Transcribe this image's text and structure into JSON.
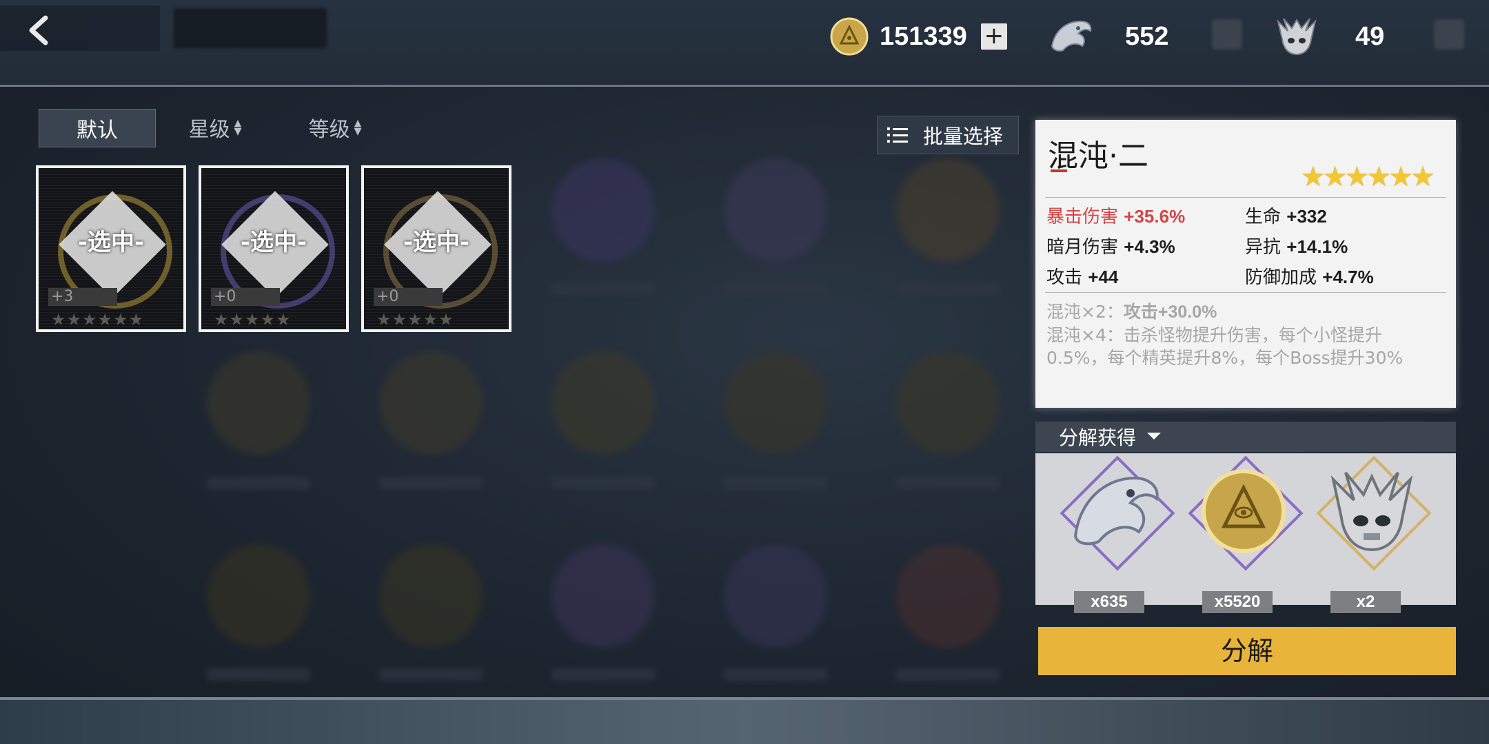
{
  "top": {
    "coins": "151339",
    "dragon_shards": "552",
    "skull_tokens": "49",
    "plus_label": "+"
  },
  "sort": {
    "default_label": "默认",
    "star_label": "星级",
    "level_label": "等级",
    "batch_label": "批量选择"
  },
  "cards": [
    {
      "selected": "-选中-",
      "level": "+3",
      "stars": "★★★★★★",
      "accent": "#b99a3a"
    },
    {
      "selected": "-选中-",
      "level": "+0",
      "stars": "★★★★★",
      "accent": "#6b5bb0"
    },
    {
      "selected": "-选中-",
      "level": "+0",
      "stars": "★★★★★",
      "accent": "#8f7a4a"
    }
  ],
  "detail": {
    "name": "混沌·二",
    "stars": "★★★★★★",
    "stats": [
      {
        "label": "暴击伤害",
        "value": "+35.6%"
      },
      {
        "label": "生命",
        "value": "+332"
      },
      {
        "label": "暗月伤害",
        "value": "+4.3%"
      },
      {
        "label": "异抗",
        "value": "+14.1%"
      },
      {
        "label": "攻击",
        "value": "+44"
      },
      {
        "label": "防御加成",
        "value": "+4.7%"
      }
    ],
    "set2_label": "混沌×2：",
    "set2_value": "攻击+30.0%",
    "set4_label": "混沌×4：",
    "set4_value": "击杀怪物提升伤害，每个小怪提升0.5%，每个精英提升8%，每个Boss提升30%"
  },
  "salvage": {
    "header": "分解获得",
    "rewards": [
      {
        "icon": "dragon-shard-icon",
        "count": "x635",
        "frame_color": "#8b6cc4"
      },
      {
        "icon": "gold-coin-icon",
        "count": "x5520",
        "frame_color": "#8b6cc4"
      },
      {
        "icon": "skull-token-icon",
        "count": "x2",
        "frame_color": "#d6b163"
      }
    ],
    "button_label": "分解"
  },
  "colors": {
    "accent_yellow": "#e8b53a",
    "stat_red": "#d64545",
    "star_gold": "#f3c634"
  }
}
